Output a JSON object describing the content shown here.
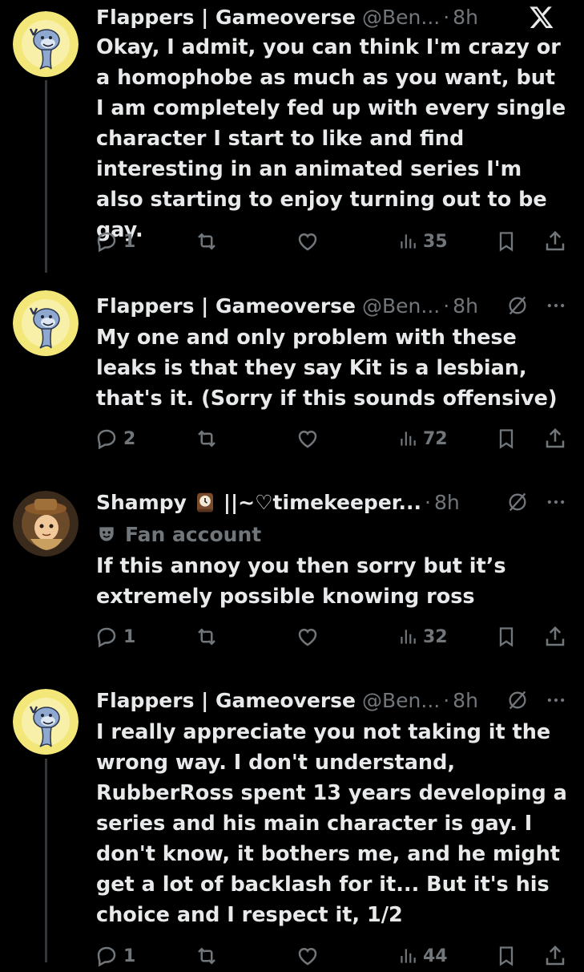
{
  "app": {
    "logo_icon": "x-logo-icon"
  },
  "tweets": [
    {
      "name": "Flappers | Gameoverse",
      "handle": "@Ben...",
      "dot": "·",
      "time": "8h",
      "text": "Okay, I admit, you can think I'm crazy or a homophobe as much as you want, but I am completely fed up with every single character I start to like and find interesting in an animated series I'm also starting to enjoy turning out to be gay.",
      "replies": "1",
      "reposts": "",
      "likes": "",
      "views": "35"
    },
    {
      "name": "Flappers | Gameoverse",
      "handle": "@Ben...",
      "dot": "·",
      "time": "8h",
      "text": "My one and only problem with these leaks is that they say Kit is a lesbian, that's it. (Sorry if this sounds offensive)",
      "replies": "2",
      "reposts": "",
      "likes": "",
      "views": "72"
    },
    {
      "name": "Shampy",
      "name_suffix": "||~♡timekeeper...",
      "dot": "·",
      "time": "8h",
      "badge": "Fan account",
      "text": "If this annoy you then sorry but it’s extremely possible knowing ross",
      "replies": "1",
      "reposts": "",
      "likes": "",
      "views": "32"
    },
    {
      "name": "Flappers | Gameoverse",
      "handle": "@Ben...",
      "dot": "·",
      "time": "8h",
      "text": "I really appreciate you not taking it the wrong way. I don't understand, RubberRoss spent 13 years developing a series and his main character is gay. I don't know, it bothers me, and he might get a lot of backlash for it... But it's his choice and I respect it, 1/2",
      "replies": "1",
      "reposts": "",
      "likes": "",
      "views": "44"
    }
  ],
  "colors": {
    "background": "#000000",
    "text": "#e7e9ea",
    "muted": "#71767b",
    "avatar_bg": "#f5e66a"
  }
}
